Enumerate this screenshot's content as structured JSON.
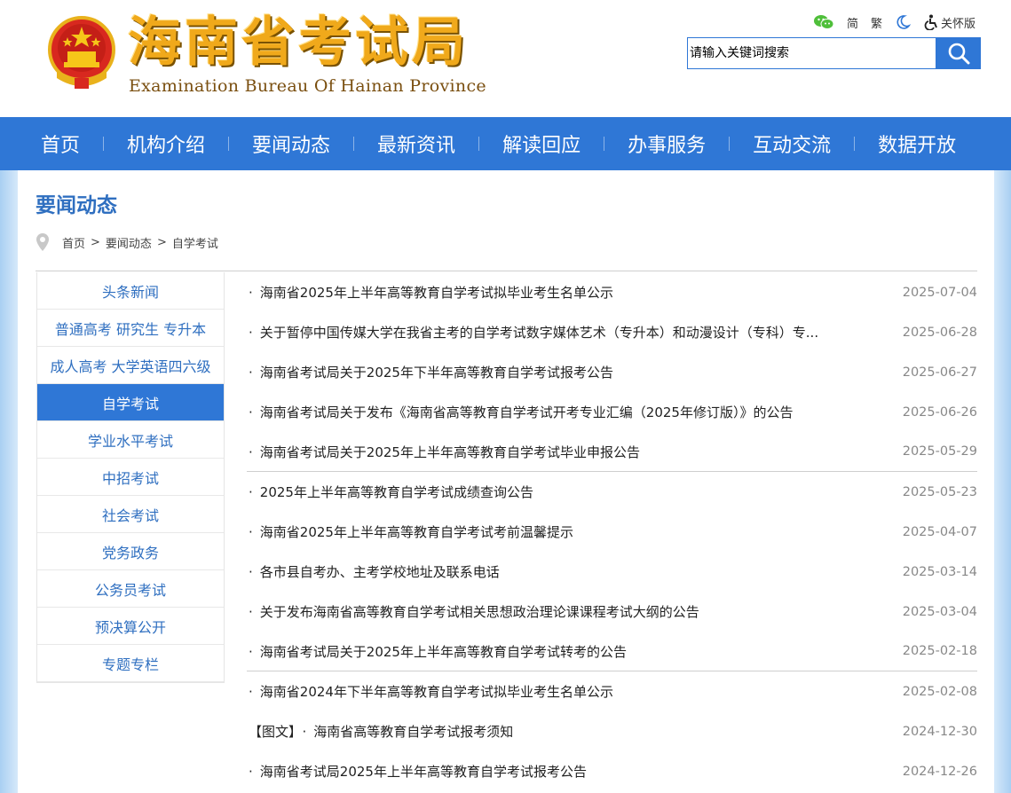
{
  "header": {
    "logo_cn": "海南省考试局",
    "logo_en": "Examination Bureau Of Hainan Province",
    "toolbar": {
      "simplified": "简",
      "traditional": "繁",
      "care_mode": "关怀版"
    },
    "search": {
      "placeholder": "请输入关键词搜索"
    }
  },
  "nav": {
    "items": [
      "首页",
      "机构介绍",
      "要闻动态",
      "最新资讯",
      "解读回应",
      "办事服务",
      "互动交流",
      "数据开放"
    ]
  },
  "section": {
    "title": "要闻动态",
    "breadcrumb": [
      "首页",
      "要闻动态",
      "自学考试"
    ],
    "breadcrumb_sep": ">"
  },
  "sidebar": {
    "items": [
      "头条新闻",
      "普通高考 研究生 专升本",
      "成人高考 大学英语四六级",
      "自学考试",
      "学业水平考试",
      "中招考试",
      "社会考试",
      "党务政务",
      "公务员考试",
      "预决算公开",
      "专题专栏"
    ],
    "active_index": 3
  },
  "list": {
    "bullet": "·",
    "rows": [
      {
        "prefix": "",
        "title": "海南省2025年上半年高等教育自学考试拟毕业考生名单公示",
        "date": "2025-07-04"
      },
      {
        "prefix": "",
        "title": "关于暂停中国传媒大学在我省主考的自学考试数字媒体艺术（专升本）和动漫设计（专科）专...",
        "date": "2025-06-28"
      },
      {
        "prefix": "",
        "title": "海南省考试局关于2025年下半年高等教育自学考试报考公告",
        "date": "2025-06-27"
      },
      {
        "prefix": "",
        "title": "海南省考试局关于发布《海南省高等教育自学考试开考专业汇编（2025年修订版）》的公告",
        "date": "2025-06-26"
      },
      {
        "prefix": "",
        "title": "海南省考试局关于2025年上半年高等教育自学考试毕业申报公告",
        "date": "2025-05-29"
      },
      {
        "prefix": "",
        "title": "2025年上半年高等教育自学考试成绩查询公告",
        "date": "2025-05-23"
      },
      {
        "prefix": "",
        "title": "海南省2025年上半年高等教育自学考试考前温馨提示",
        "date": "2025-04-07"
      },
      {
        "prefix": "",
        "title": "各市县自考办、主考学校地址及联系电话",
        "date": "2025-03-14"
      },
      {
        "prefix": "",
        "title": "关于发布海南省高等教育自学考试相关思想政治理论课课程考试大纲的公告",
        "date": "2025-03-04"
      },
      {
        "prefix": "",
        "title": "海南省考试局关于2025年上半年高等教育自学考试转考的公告",
        "date": "2025-02-18"
      },
      {
        "prefix": "",
        "title": "海南省2024年下半年高等教育自学考试拟毕业考生名单公示",
        "date": "2025-02-08"
      },
      {
        "prefix": "【图文】",
        "title": "海南省高等教育自学考试报考须知",
        "date": "2024-12-30"
      },
      {
        "prefix": "",
        "title": "海南省考试局2025年上半年高等教育自学考试报考公告",
        "date": "2024-12-26"
      }
    ]
  },
  "colors": {
    "primary": "#2f77d6",
    "logo_gold": "#f0a91b",
    "title_blue": "#2f6fc0"
  }
}
